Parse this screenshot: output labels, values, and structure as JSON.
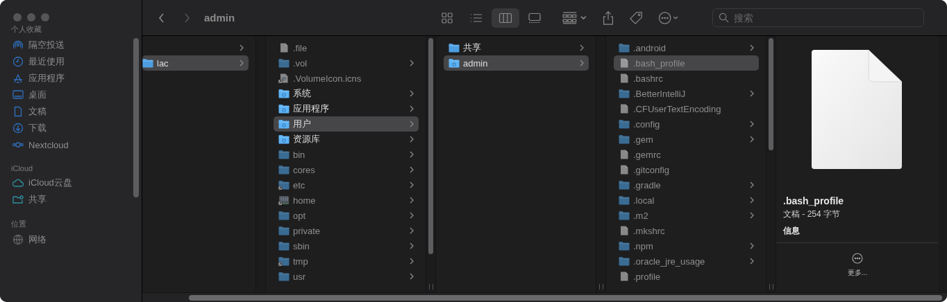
{
  "window": {
    "title": "admin"
  },
  "sidebar": {
    "sections": [
      {
        "heading": "个人收藏",
        "items": [
          {
            "label": "隔空投送",
            "kind": "airdrop"
          },
          {
            "label": "最近使用",
            "kind": "clock"
          },
          {
            "label": "应用程序",
            "kind": "apps"
          },
          {
            "label": "桌面",
            "kind": "desktop"
          },
          {
            "label": "文稿",
            "kind": "document"
          },
          {
            "label": "下载",
            "kind": "download"
          },
          {
            "label": "Nextcloud",
            "kind": "nextcloud"
          }
        ]
      },
      {
        "heading": "iCloud",
        "items": [
          {
            "label": "iCloud云盘",
            "kind": "cloud"
          },
          {
            "label": "共享",
            "kind": "shared"
          }
        ]
      },
      {
        "heading": "位置",
        "items": [
          {
            "label": "网络",
            "kind": "globe"
          }
        ]
      }
    ]
  },
  "toolbar": {
    "view_modes": [
      {
        "kind": "icons",
        "selected": false
      },
      {
        "kind": "list",
        "selected": false
      },
      {
        "kind": "columns",
        "selected": true
      },
      {
        "kind": "gallery",
        "selected": false
      }
    ],
    "search": {
      "placeholder": "搜索"
    }
  },
  "columns": [
    {
      "items": [
        {
          "selected": false,
          "has_children": true
        },
        {
          "name": "lac",
          "kind": "folder",
          "selected": true,
          "hidden": false,
          "has_children": true
        }
      ]
    },
    {
      "items": [
        {
          "name": ".file",
          "kind": "file",
          "selected": false,
          "hidden": true,
          "has_children": false
        },
        {
          "name": ".vol",
          "kind": "folder",
          "selected": false,
          "hidden": true,
          "has_children": true
        },
        {
          "name": ".VolumeIcon.icns",
          "kind": "icns",
          "alias": true,
          "selected": false,
          "hidden": true,
          "has_children": false
        },
        {
          "name": "系统",
          "kind": "special",
          "selected": false,
          "hidden": false,
          "has_children": true
        },
        {
          "name": "应用程序",
          "kind": "special",
          "selected": false,
          "hidden": false,
          "has_children": true
        },
        {
          "name": "用户",
          "kind": "special",
          "selected": true,
          "hidden": false,
          "has_children": true
        },
        {
          "name": "资源库",
          "kind": "special",
          "selected": false,
          "hidden": false,
          "has_children": true
        },
        {
          "name": "bin",
          "kind": "folder",
          "selected": false,
          "hidden": true,
          "has_children": true
        },
        {
          "name": "cores",
          "kind": "folder",
          "selected": false,
          "hidden": true,
          "has_children": true
        },
        {
          "name": "etc",
          "kind": "folder",
          "alias": true,
          "selected": false,
          "hidden": true,
          "has_children": true
        },
        {
          "name": "home",
          "kind": "drive",
          "alias": true,
          "selected": false,
          "hidden": true,
          "has_children": true
        },
        {
          "name": "opt",
          "kind": "folder",
          "selected": false,
          "hidden": true,
          "has_children": true
        },
        {
          "name": "private",
          "kind": "folder",
          "selected": false,
          "hidden": true,
          "has_children": true
        },
        {
          "name": "sbin",
          "kind": "folder",
          "selected": false,
          "hidden": true,
          "has_children": true
        },
        {
          "name": "tmp",
          "kind": "folder",
          "alias": true,
          "selected": false,
          "hidden": true,
          "has_children": true
        },
        {
          "name": "usr",
          "kind": "folder",
          "selected": false,
          "hidden": true,
          "has_children": true
        }
      ]
    },
    {
      "items": [
        {
          "name": "共享",
          "kind": "folder",
          "selected": false,
          "hidden": false,
          "has_children": true
        },
        {
          "name": "admin",
          "kind": "special",
          "selected": true,
          "hidden": false,
          "has_children": true
        }
      ]
    },
    {
      "items": [
        {
          "name": ".android",
          "kind": "folder",
          "selected": false,
          "hidden": true,
          "has_children": true
        },
        {
          "name": ".bash_profile",
          "kind": "file",
          "selected": true,
          "hidden": true,
          "has_children": false
        },
        {
          "name": ".bashrc",
          "kind": "file",
          "selected": false,
          "hidden": true,
          "has_children": false
        },
        {
          "name": ".BetterIntelliJ",
          "kind": "folder",
          "selected": false,
          "hidden": true,
          "has_children": true
        },
        {
          "name": ".CFUserTextEncoding",
          "kind": "file",
          "selected": false,
          "hidden": true,
          "has_children": false
        },
        {
          "name": ".config",
          "kind": "folder",
          "selected": false,
          "hidden": true,
          "has_children": true
        },
        {
          "name": ".gem",
          "kind": "folder",
          "selected": false,
          "hidden": true,
          "has_children": true
        },
        {
          "name": ".gemrc",
          "kind": "file",
          "selected": false,
          "hidden": true,
          "has_children": false
        },
        {
          "name": ".gitconfig",
          "kind": "file",
          "selected": false,
          "hidden": true,
          "has_children": false
        },
        {
          "name": ".gradle",
          "kind": "folder",
          "selected": false,
          "hidden": true,
          "has_children": true
        },
        {
          "name": ".local",
          "kind": "folder",
          "selected": false,
          "hidden": true,
          "has_children": true
        },
        {
          "name": ".m2",
          "kind": "folder",
          "selected": false,
          "hidden": true,
          "has_children": true
        },
        {
          "name": ".mkshrc",
          "kind": "file",
          "selected": false,
          "hidden": true,
          "has_children": false
        },
        {
          "name": ".npm",
          "kind": "folder",
          "selected": false,
          "hidden": true,
          "has_children": true
        },
        {
          "name": ".oracle_jre_usage",
          "kind": "folder",
          "selected": false,
          "hidden": true,
          "has_children": true
        },
        {
          "name": ".profile",
          "kind": "file",
          "selected": false,
          "hidden": true,
          "has_children": false
        }
      ]
    }
  ],
  "preview": {
    "name": ".bash_profile",
    "info": "文稿 - 254 字节",
    "section": "信息",
    "more": "更多..."
  }
}
